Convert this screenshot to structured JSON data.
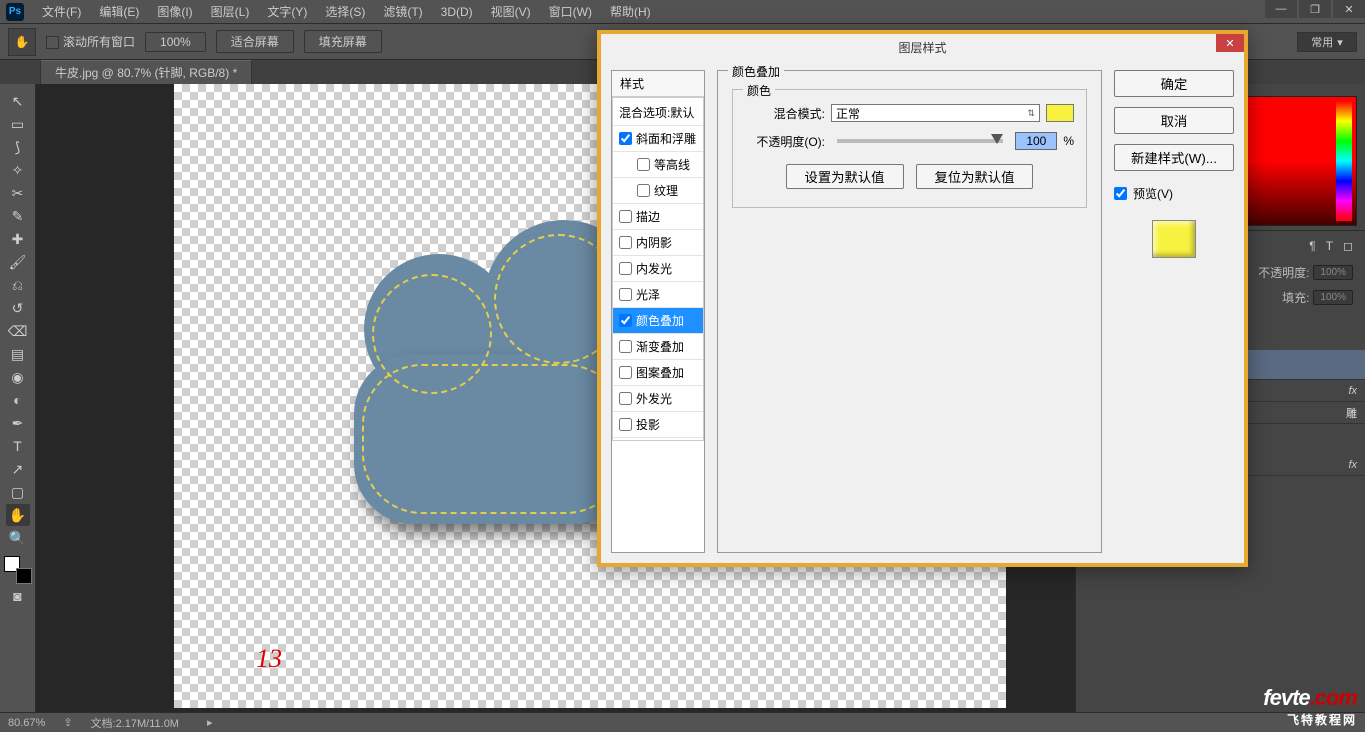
{
  "app": {
    "logo": "Ps"
  },
  "menu": {
    "items": [
      "文件(F)",
      "编辑(E)",
      "图像(I)",
      "图层(L)",
      "文字(Y)",
      "选择(S)",
      "滤镜(T)",
      "3D(D)",
      "视图(V)",
      "窗口(W)",
      "帮助(H)"
    ]
  },
  "options": {
    "scrollAll": "滚动所有窗口",
    "btn100": "100%",
    "btnFit": "适合屏幕",
    "btnFill": "填充屏幕",
    "preset": "常用"
  },
  "tab": {
    "title": "牛皮.jpg @ 80.7% (针脚, RGB/8) *"
  },
  "canvas": {
    "annotation": "13"
  },
  "rightPanel": {
    "opacityLabel": "不透明度:",
    "opacityValue": "100%",
    "fillLabel": "填充:",
    "fillValue": "100%",
    "fx": "fx",
    "fx2": "fx",
    "effectLabel": "雕"
  },
  "status": {
    "zoom": "80.67%",
    "docsize": "文档:2.17M/11.0M"
  },
  "dialog": {
    "title": "图层样式",
    "sidebar": {
      "head": "样式",
      "blendDefault": "混合选项:默认",
      "items": [
        {
          "label": "斜面和浮雕",
          "checked": true
        },
        {
          "label": "等高线",
          "indent": true,
          "checked": false
        },
        {
          "label": "纹理",
          "indent": true,
          "checked": false
        },
        {
          "label": "描边",
          "checked": false
        },
        {
          "label": "内阴影",
          "checked": false
        },
        {
          "label": "内发光",
          "checked": false
        },
        {
          "label": "光泽",
          "checked": false
        },
        {
          "label": "颜色叠加",
          "checked": true,
          "selected": true
        },
        {
          "label": "渐变叠加",
          "checked": false
        },
        {
          "label": "图案叠加",
          "checked": false
        },
        {
          "label": "外发光",
          "checked": false
        },
        {
          "label": "投影",
          "checked": false
        }
      ]
    },
    "group": {
      "legend": "颜色叠加",
      "innerLegend": "颜色",
      "blendModeLabel": "混合模式:",
      "blendModeValue": "正常",
      "opacityLabel": "不透明度(O):",
      "opacityValue": "100",
      "opacityUnit": "%",
      "btnSetDefault": "设置为默认值",
      "btnResetDefault": "复位为默认值"
    },
    "buttons": {
      "ok": "确定",
      "cancel": "取消",
      "newStyle": "新建样式(W)...",
      "preview": "预览(V)"
    }
  },
  "watermark": {
    "text1": "fevte",
    "text2": ".com",
    "sub": "飞特教程网"
  }
}
